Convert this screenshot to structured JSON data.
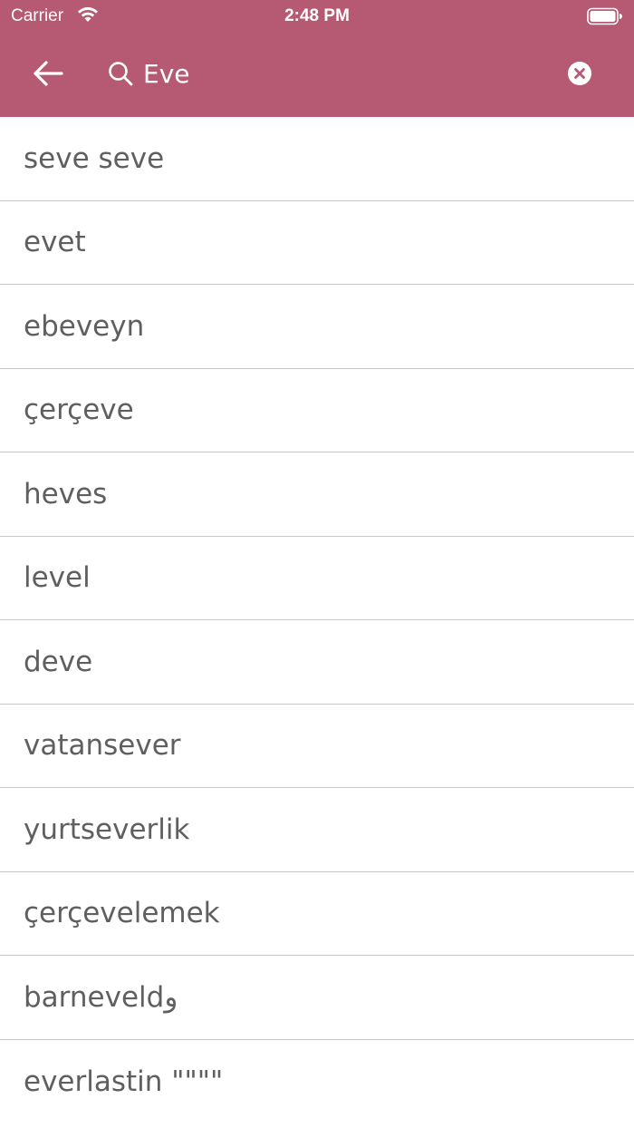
{
  "status_bar": {
    "carrier": "Carrier",
    "time": "2:48 PM"
  },
  "header": {
    "background_color": "#b55a72",
    "back_icon": "arrow-left-icon",
    "search_icon": "search-icon",
    "clear_icon": "clear-circle-x-icon"
  },
  "search": {
    "value": "Eve",
    "placeholder": ""
  },
  "results": [
    "seve seve",
    "evet",
    "ebeveyn",
    "çerçeve",
    "heves",
    "level",
    "deve",
    "vatansever",
    "yurtseverlik",
    "çerçevelemek",
    "barneveldو",
    "everlastin \"\"\"\""
  ]
}
